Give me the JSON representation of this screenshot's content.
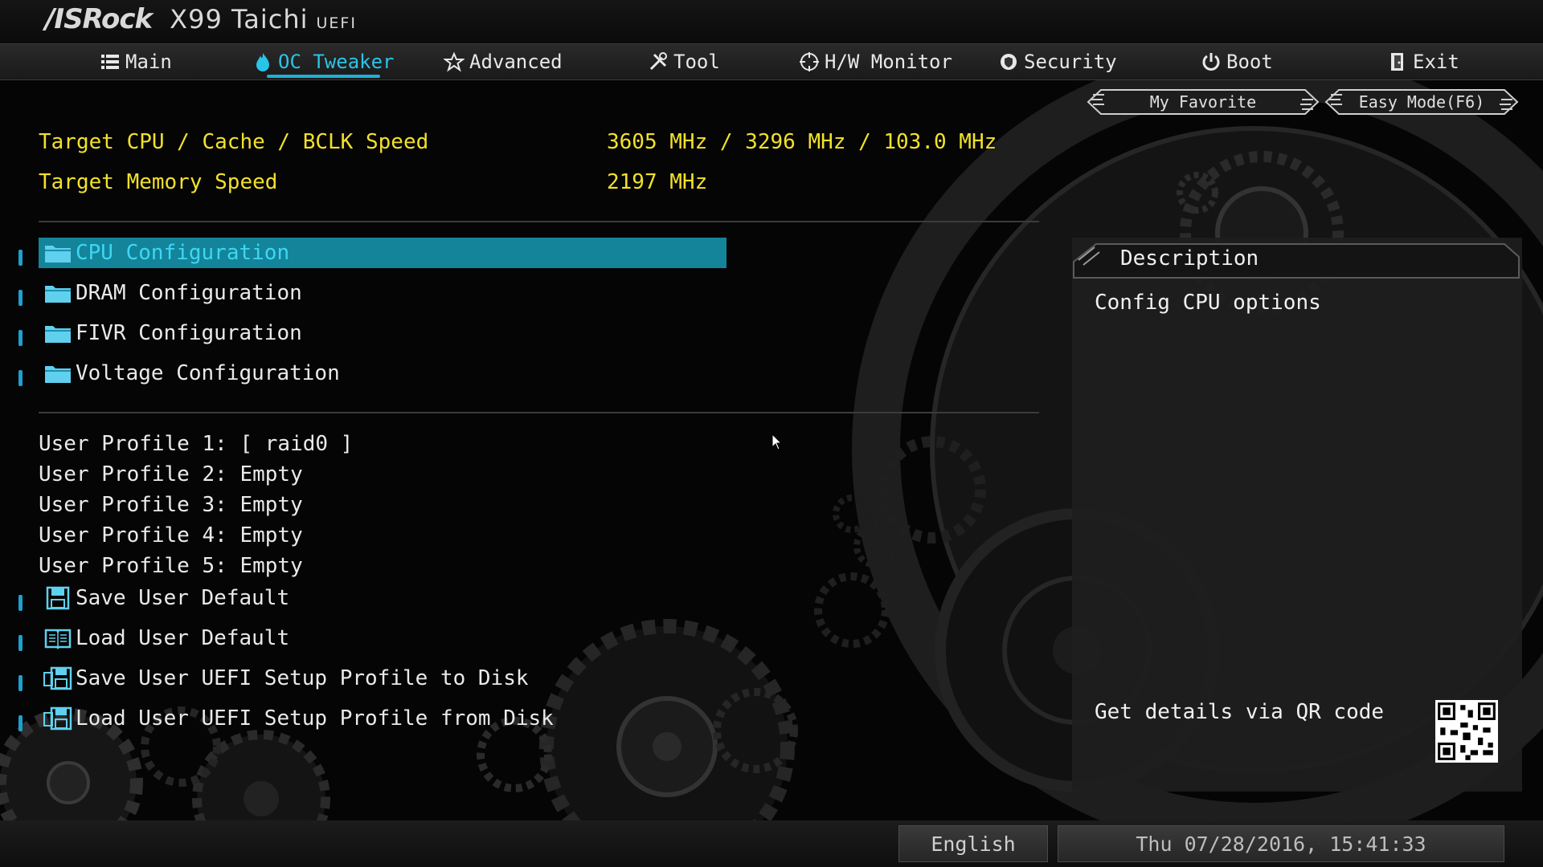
{
  "header": {
    "brand": "/ISRock",
    "model": "X99 Taichi",
    "uefi_tag": "UEFI"
  },
  "nav": {
    "tabs": [
      {
        "label": "Main",
        "icon": "list-icon"
      },
      {
        "label": "OC Tweaker",
        "icon": "flame-icon",
        "active": true
      },
      {
        "label": "Advanced",
        "icon": "star-icon"
      },
      {
        "label": "Tool",
        "icon": "tools-icon"
      },
      {
        "label": "H/W Monitor",
        "icon": "crosshair-icon"
      },
      {
        "label": "Security",
        "icon": "shield-icon"
      },
      {
        "label": "Boot",
        "icon": "power-icon"
      },
      {
        "label": "Exit",
        "icon": "exit-door-icon"
      }
    ]
  },
  "buttons": {
    "favorite": "My Favorite",
    "easy_mode": "Easy Mode(F6)"
  },
  "targets": {
    "cpu_label": "Target CPU / Cache / BCLK Speed",
    "cpu_value": "3605 MHz / 3296 MHz / 103.0 MHz",
    "mem_label": "Target Memory Speed",
    "mem_value": "2197 MHz"
  },
  "menu": [
    {
      "label": "CPU Configuration",
      "selected": true,
      "icon": "folder-icon"
    },
    {
      "label": "DRAM Configuration",
      "icon": "folder-icon"
    },
    {
      "label": "FIVR Configuration",
      "icon": "folder-icon"
    },
    {
      "label": "Voltage Configuration",
      "icon": "folder-icon"
    }
  ],
  "profiles": [
    "User Profile 1: [ raid0 ]",
    "User Profile 2: Empty",
    "User Profile 3: Empty",
    "User Profile 4: Empty",
    "User Profile 5: Empty"
  ],
  "actions": [
    {
      "label": "Save User Default",
      "icon": "floppy-icon"
    },
    {
      "label": "Load User Default",
      "icon": "book-icon"
    },
    {
      "label": "Save User UEFI Setup Profile to Disk",
      "icon": "disk-save-icon"
    },
    {
      "label": "Load User UEFI Setup Profile from Disk",
      "icon": "disk-load-icon"
    }
  ],
  "description": {
    "title": "Description",
    "text": "Config CPU options",
    "qr_label": "Get details via QR code"
  },
  "status": {
    "language": "English",
    "datetime": "Thu 07/28/2016, 15:41:33"
  },
  "colors": {
    "accent": "#29c4e8",
    "highlight": "#13849a",
    "target_text": "#f2e12a"
  }
}
